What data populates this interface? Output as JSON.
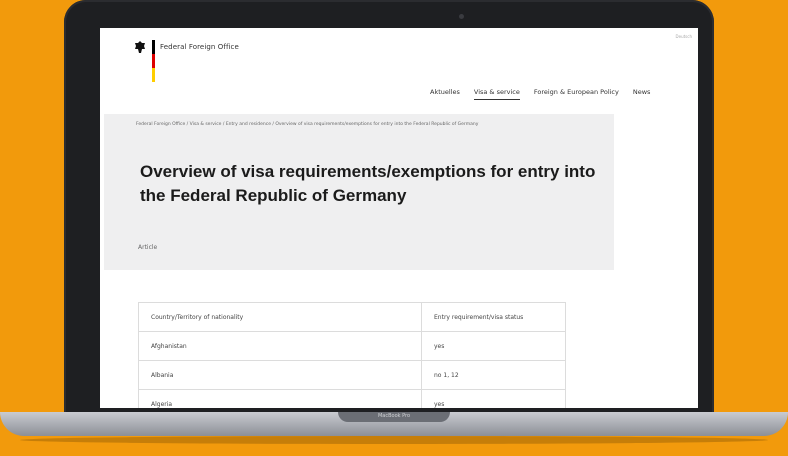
{
  "site": {
    "org_name": "Federal Foreign Office",
    "corner_link": "Deutsch",
    "nav": [
      "Aktuelles",
      "Visa & service",
      "Foreign & European Policy",
      "News"
    ],
    "nav_active_index": 1,
    "breadcrumb": "Federal Foreign Office  /  Visa & service  /  Entry and residence  /  Overview of visa requirements/exemptions for entry into the Federal Republic of Germany",
    "title": "Overview of visa requirements/exemptions for entry into the Federal Republic of Germany",
    "article_tag": "Article",
    "table": {
      "headers": [
        "Country/Territory of nationality",
        "Entry requirement/visa status"
      ],
      "rows": [
        [
          "Afghanistan",
          "yes"
        ],
        [
          "Albania",
          "no 1, 12"
        ],
        [
          "Algeria",
          "yes"
        ]
      ]
    }
  },
  "device": {
    "brand_label": "MacBook Pro"
  },
  "colors": {
    "background": "#f29a0c",
    "flag_black": "#000000",
    "flag_red": "#dd0000",
    "flag_gold": "#ffce00"
  }
}
